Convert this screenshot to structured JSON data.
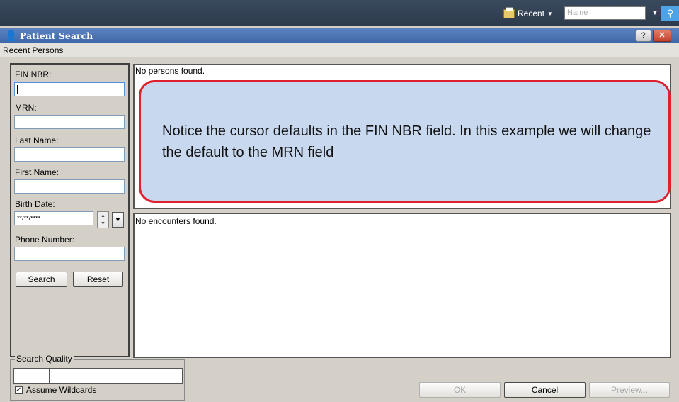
{
  "topbar": {
    "recent_label": "Recent",
    "name_placeholder": "Name"
  },
  "window": {
    "title": "Patient Search"
  },
  "menu": {
    "recent_persons": "Recent Persons"
  },
  "form": {
    "fin_label": "FIN NBR:",
    "fin_value": "",
    "mrn_label": "MRN:",
    "last_name_label": "Last Name:",
    "first_name_label": "First Name:",
    "birth_date_label": "Birth Date:",
    "birth_date_value": "**/**/****",
    "phone_label": "Phone Number:",
    "search_button": "Search",
    "reset_button": "Reset"
  },
  "results": {
    "persons_empty": "No persons found.",
    "encounters_empty": "No encounters found."
  },
  "callout": {
    "text": "Notice the cursor defaults in the FIN NBR field.  In this example we will change the default to the MRN field"
  },
  "search_quality": {
    "group_label": "Search Quality",
    "assume_wildcards_label": "Assume Wildcards",
    "assume_wildcards_checked": true
  },
  "footer": {
    "ok_button": "OK",
    "cancel_button": "Cancel",
    "preview_button": "Preview..."
  },
  "colors": {
    "callout_border": "#e0202c",
    "callout_fill": "#c8d8ee",
    "title_bar": "#4a72b4"
  },
  "icons": [
    "folder-stack-icon",
    "search-icon",
    "patient-search-icon",
    "help-icon",
    "close-icon",
    "spinner-arrows-icon",
    "chevron-down-icon",
    "checkmark-icon"
  ]
}
